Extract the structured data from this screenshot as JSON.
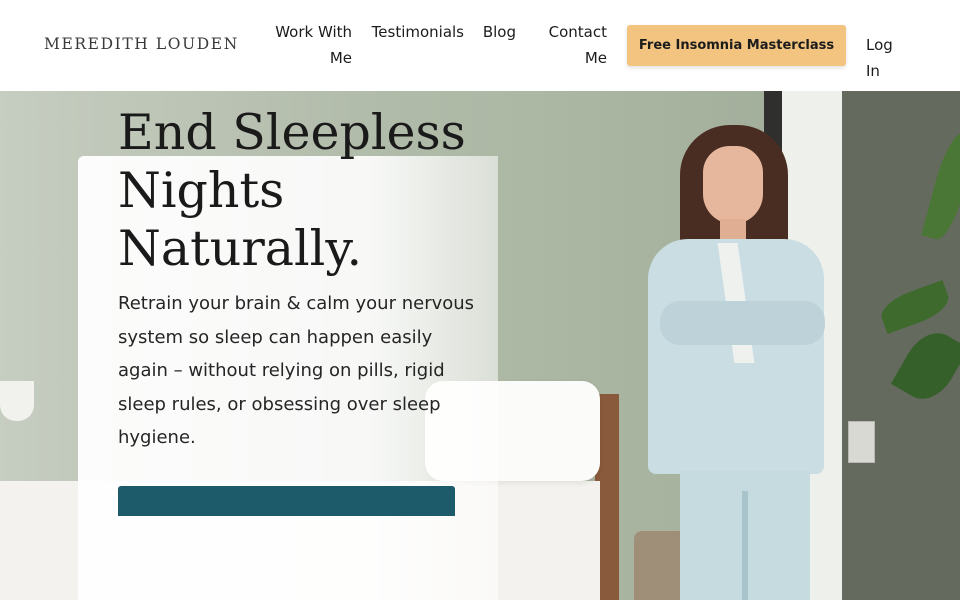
{
  "header": {
    "logo": "MEREDITH LOUDEN",
    "nav": {
      "work_with_me": "Work With Me",
      "testimonials": "Testimonials",
      "blog": "Blog",
      "contact_me": "Contact Me"
    },
    "cta_label": "Free Insomnia Masterclass",
    "login_label": "Log In"
  },
  "hero": {
    "headline": "End Sleepless Nights Naturally.",
    "subtext": "Retrain your brain & calm your nervous system so sleep can happen easily again – without relying on pills, rigid sleep rules, or obsessing over sleep hygiene.",
    "button_color": "#1d5a6a"
  },
  "colors": {
    "cta_background": "#f2c480",
    "text": "#1c1c1c"
  }
}
